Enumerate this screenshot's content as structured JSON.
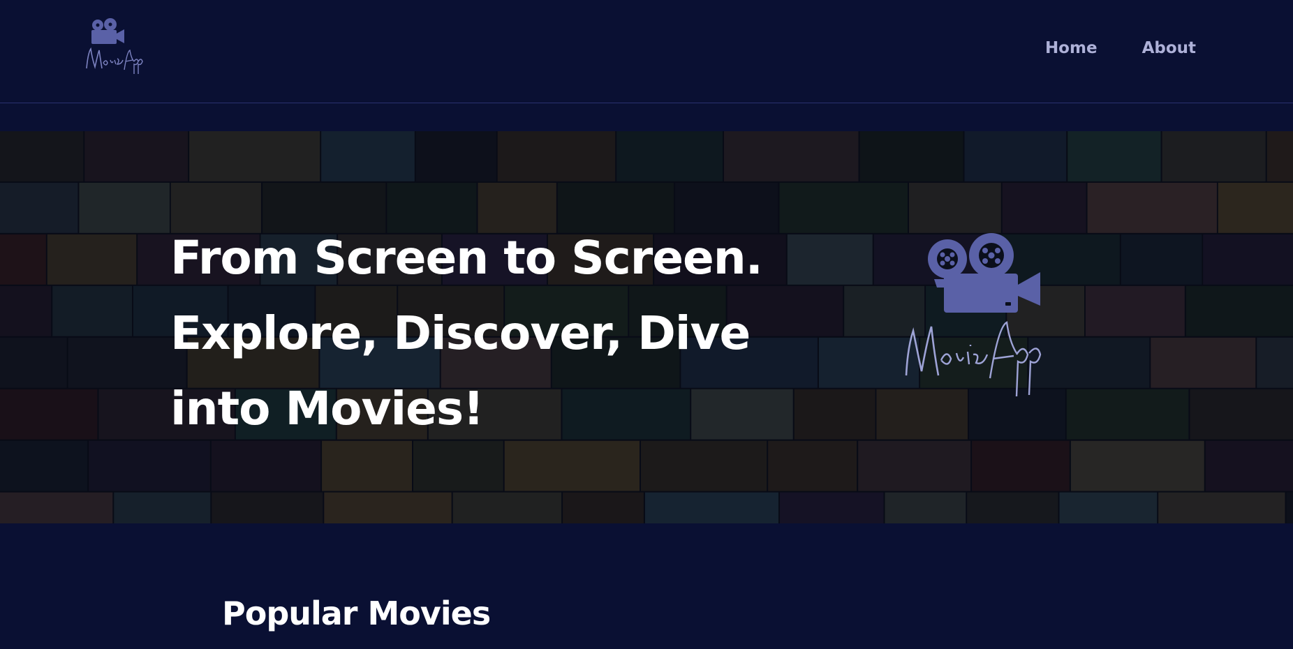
{
  "header": {
    "logo_icon": "movie-camera-icon",
    "nav": [
      {
        "label": "Home"
      },
      {
        "label": "About"
      }
    ]
  },
  "hero": {
    "lines": [
      "From Screen to Screen.",
      "Explore, Discover, Dive",
      "into Movies!"
    ],
    "logo_icon": "movie-camera-icon"
  },
  "main": {
    "section_title": "Popular Movies"
  },
  "colors": {
    "background": "#0a1033",
    "accent": "#5a61a7",
    "nav_text": "#aeb1d8",
    "heading_text": "#ffffff"
  }
}
